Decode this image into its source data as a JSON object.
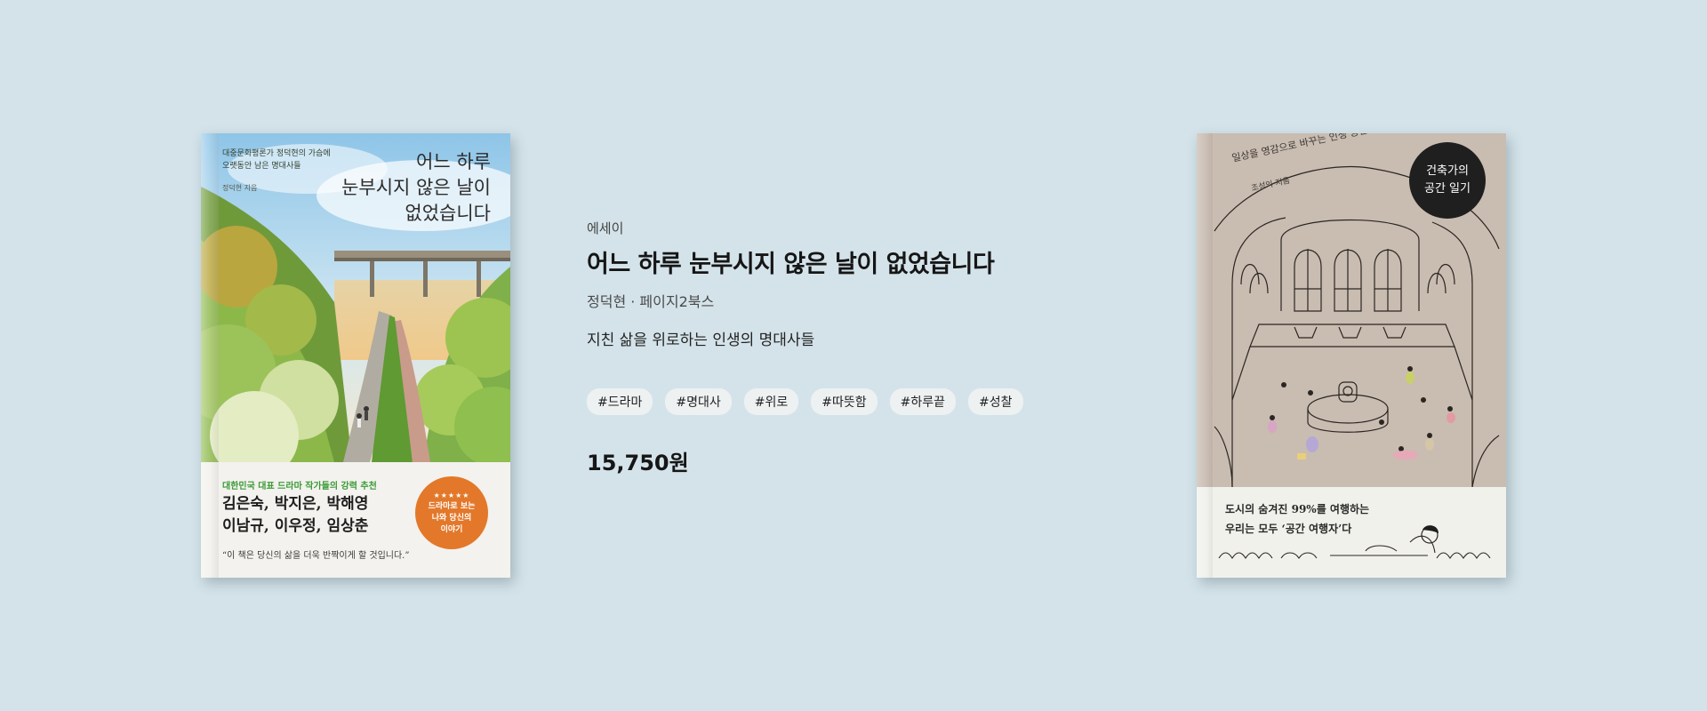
{
  "book_left": {
    "teaser_line1": "대중문화평론가 정덕현의 가슴에",
    "teaser_line2": "오랫동안 남은 명대사들",
    "title_line1": "어느 하루",
    "title_line2": "눈부시지 않은 날이",
    "title_line3": "없었습니다",
    "author": "정덕현 지음",
    "recommend": "대한민국 대표 드라마 작가들의 강력 추천",
    "names_line1": "김은숙, 박지은, 박해영",
    "names_line2": "이남규, 이우정, 임상춘",
    "quote": "“이 책은 당신의 삶을 더욱 반짝이게 할 것입니다.”",
    "badge_stars": "★★★★★",
    "badge_line1": "드라마로 보는",
    "badge_line2": "나와 당신의",
    "badge_line3": "이야기"
  },
  "info": {
    "category": "에세이",
    "title": "어느 하루 눈부시지 않은 날이 없었습니다",
    "meta": "정덕현 · 페이지2북스",
    "subtitle": "지친 삶을 위로하는 인생의 명대사들",
    "tags": [
      "#드라마",
      "#명대사",
      "#위로",
      "#따뜻함",
      "#하루끝",
      "#성찰"
    ],
    "price": "15,750원"
  },
  "book_right": {
    "arc_text": "일상을 영감으로 바꾸는 인생 공간",
    "author": "조성익 지음",
    "circle_line1": "건축가의",
    "circle_line2": "공간 일기",
    "tagline_line1": "도시의 숨겨진 99%를 여행하는",
    "tagline_line2": "우리는 모두 ‘공간 여행자’다"
  },
  "colors": {
    "background": "#d4e3ea",
    "badge_orange": "#e3782a",
    "recommend_green": "#3a9b36",
    "tag_bg": "#eef1f2"
  }
}
